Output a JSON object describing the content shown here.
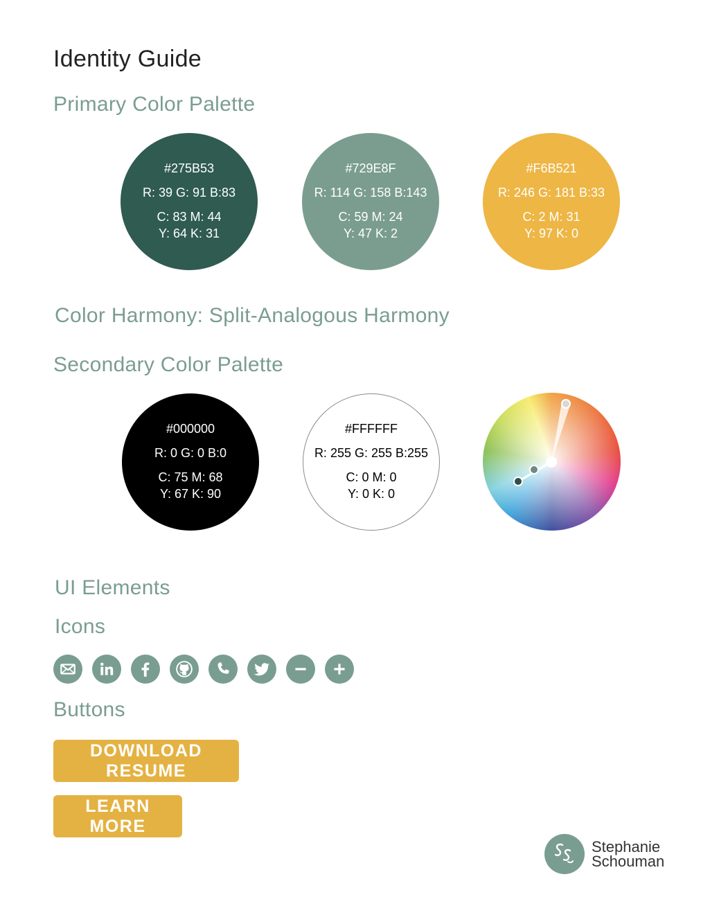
{
  "page": {
    "title": "Identity Guide",
    "primary_heading": "Primary Color Palette",
    "harmony_heading": "Color Harmony: Split-Analogous Harmony",
    "secondary_heading": "Secondary Color Palette",
    "ui_heading": "UI Elements",
    "icons_heading": "Icons",
    "buttons_heading": "Buttons"
  },
  "primary_colors": [
    {
      "hex": "#275B53",
      "rgb": "R: 39 G: 91 B:83",
      "cmyk1": "C: 83 M: 44",
      "cmyk2": "Y: 64 K: 31",
      "fill": "#2f5b51",
      "text_color": "#ffffff"
    },
    {
      "hex": "#729E8F",
      "rgb": "R: 114 G: 158 B:143",
      "cmyk1": "C: 59 M: 24",
      "cmyk2": "Y: 47 K: 2",
      "fill": "#7a9d8f",
      "text_color": "#ffffff"
    },
    {
      "hex": "#F6B521",
      "rgb": "R: 246 G: 181 B:33",
      "cmyk1": "C: 2 M: 31",
      "cmyk2": "Y: 97 K: 0",
      "fill": "#edb645",
      "text_color": "#ffffff"
    }
  ],
  "secondary_colors": [
    {
      "hex": "#000000",
      "rgb": "R: 0 G: 0 B:0",
      "cmyk1": "C: 75 M: 68",
      "cmyk2": "Y: 67 K: 90",
      "fill": "#000000",
      "text_color": "#ffffff"
    },
    {
      "hex": "#FFFFFF",
      "rgb": "R: 255 G: 255 B:255",
      "cmyk1": "C: 0 M: 0",
      "cmyk2": "Y: 0 K: 0",
      "fill": "#ffffff",
      "text_color": "#000000"
    }
  ],
  "icons": [
    "mail-icon",
    "linkedin-icon",
    "facebook-icon",
    "github-icon",
    "phone-icon",
    "twitter-icon",
    "minus-icon",
    "plus-icon"
  ],
  "buttons": {
    "download": "DOWNLOAD RESUME",
    "learn_more": "LEARN MORE"
  },
  "logo": {
    "first_name": "Stephanie",
    "last_name": "Schouman"
  },
  "colors": {
    "accent": "#7a9d91",
    "button": "#e4b243"
  }
}
